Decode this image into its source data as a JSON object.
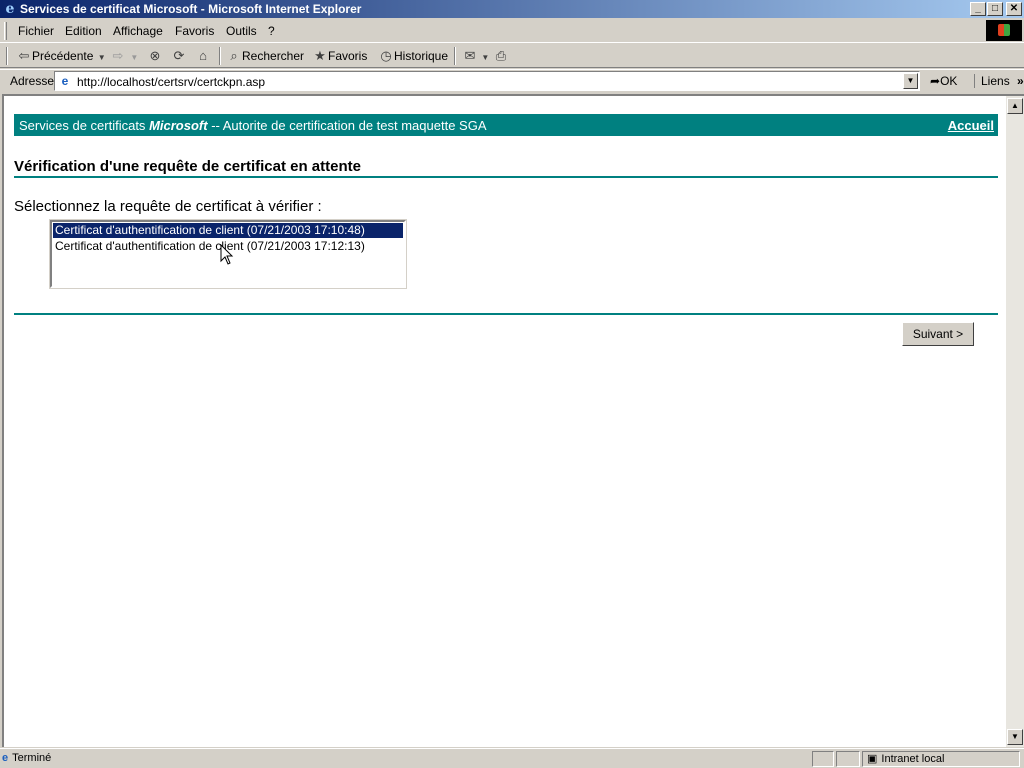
{
  "window": {
    "title": "Services de certificat Microsoft - Microsoft Internet Explorer",
    "controls": {
      "minimize": "_",
      "maximize": "□",
      "close": "✕"
    }
  },
  "menu": [
    "Fichier",
    "Edition",
    "Affichage",
    "Favoris",
    "Outils",
    "?"
  ],
  "toolbar": {
    "back": "Précédente",
    "search": "Rechercher",
    "favorites": "Favoris",
    "history": "Historique"
  },
  "address": {
    "label": "Adresse",
    "url": "http://localhost/certsrv/certckpn.asp",
    "go": "OK",
    "links": "Liens",
    "links_more": "»"
  },
  "page": {
    "banner": {
      "prefix": "Services de certificats",
      "brand": "Microsoft",
      "suffix": "-- Autorite de certification de test maquette SGA",
      "home_link": "Accueil"
    },
    "title": "Vérification d'une requête de certificat en attente",
    "prompt": "Sélectionnez la requête de certificat à vérifier :",
    "requests": [
      "Certificat d'authentification de client (07/21/2003 17:10:48)",
      "Certificat d'authentification de client (07/21/2003 17:12:13)"
    ],
    "selected_index": 0,
    "next_button": "Suivant >"
  },
  "status": {
    "text": "Terminé",
    "zone": "Intranet local"
  },
  "colors": {
    "banner": "#008080",
    "titlebar_start": "#0a246a",
    "selection": "#0a246a"
  }
}
